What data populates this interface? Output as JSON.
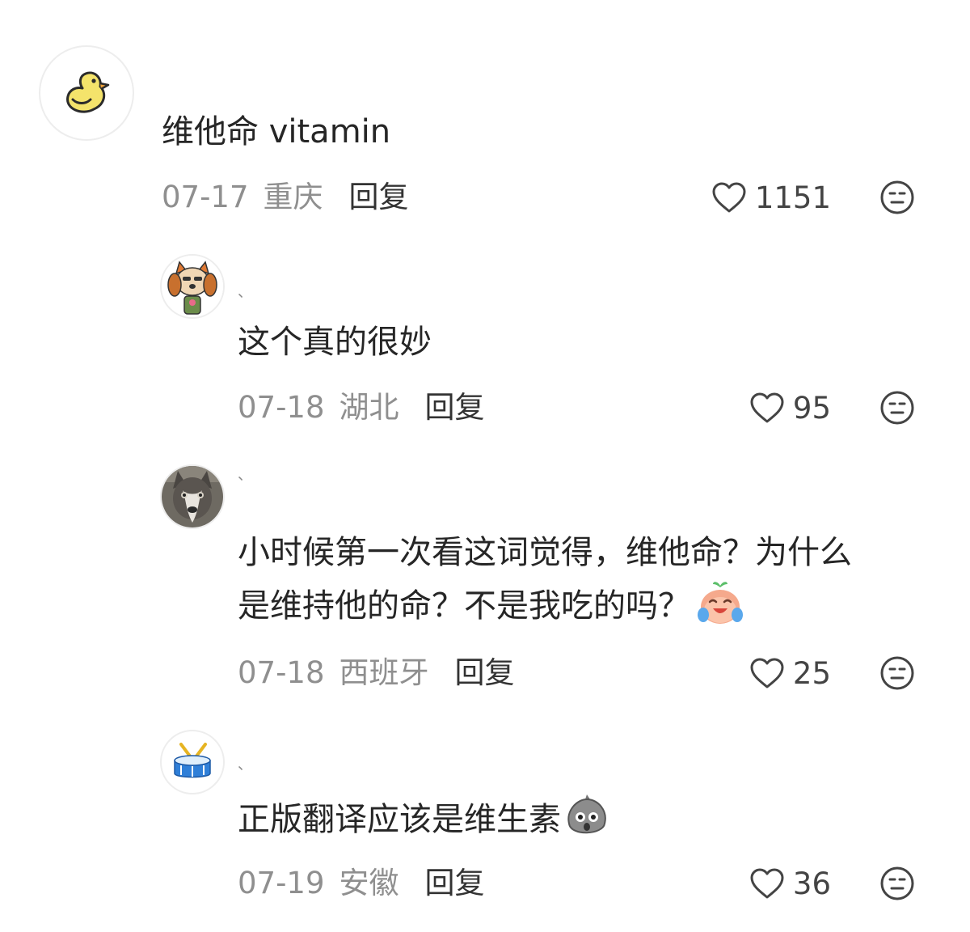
{
  "comments": [
    {
      "username": "",
      "text_lines": [
        "维他命 vitamin"
      ],
      "date": "07-17",
      "location": "重庆",
      "reply_label": "回复",
      "likes": "1151",
      "avatar_icon": "chick-icon"
    },
    {
      "username": "、",
      "text_lines": [
        "这个真的很妙"
      ],
      "date": "07-18",
      "location": "湖北",
      "reply_label": "回复",
      "likes": "95",
      "avatar_icon": "dog-cartoon-avatar"
    },
    {
      "username": "、",
      "text_lines": [
        "小时候第一次看这词觉得，维他命？为什么",
        "是维持他的命？不是我吃的吗？"
      ],
      "date": "07-18",
      "location": "西班牙",
      "reply_label": "回复",
      "likes": "25",
      "avatar_icon": "husky-photo-avatar",
      "emoji": "laugh-cry-peach-emoji"
    },
    {
      "username": "、",
      "text_lines": [
        "正版翻译应该是维生素"
      ],
      "date": "07-19",
      "location": "安徽",
      "reply_label": "回复",
      "likes": "36",
      "avatar_icon": "drum-icon",
      "emoji": "shocked-rock-emoji"
    }
  ],
  "colors": {
    "meta_gray": "#8f8f8f",
    "text": "#262626",
    "icon_stroke": "#444444"
  }
}
